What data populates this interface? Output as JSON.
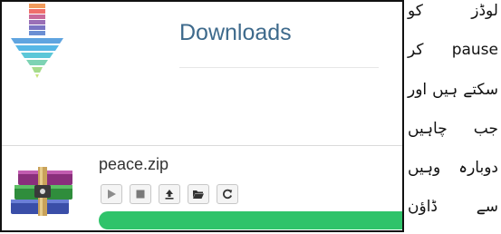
{
  "panel": {
    "title": "Downloads",
    "download": {
      "filename": "peace.zip",
      "controls": [
        "play-icon",
        "stop-icon",
        "upload-icon",
        "folder-open-icon",
        "refresh-icon"
      ],
      "progress": 1.0,
      "progress_color": "#2fc36a"
    },
    "title_color": "#3e6a8c"
  },
  "side_text": {
    "lines": [
      "لوڈز کو",
      "pause کر",
      "سکتے ہیں اور",
      "جب چاہیں",
      "دوبارہ وہیں",
      "سے ڈاؤن"
    ]
  }
}
